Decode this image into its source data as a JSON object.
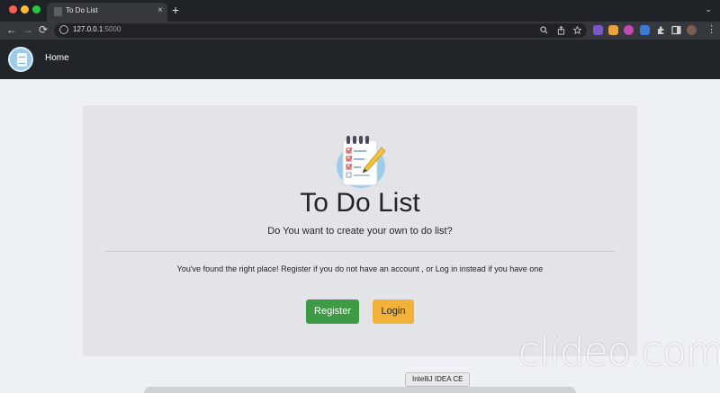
{
  "browser": {
    "tab_title": "To Do List",
    "tab_close": "×",
    "new_tab": "+",
    "tab_menu": "⌄",
    "url_host": "127.0.0.1",
    "url_port": ":5000",
    "back": "←",
    "forward": "→",
    "reload": "⟳",
    "extension_colors": [
      "#7a56c7",
      "#e8a33d",
      "#c04ab0",
      "#3b7ad9",
      "#9aa0a6",
      "#5a5a5a"
    ]
  },
  "navbar": {
    "brand_icon": "notepad-logo-icon",
    "home_label": "Home"
  },
  "hero": {
    "icon": "todo-list-clipboard-icon",
    "title": "To Do List",
    "lead": "Do You want to create your own to do list?",
    "text": "You've found the right place! Register if you do not have an account , or Log in instead if you have one",
    "register_label": "Register",
    "login_label": "Login",
    "colors": {
      "register": "#3f9a45",
      "login": "#f2b23a"
    }
  },
  "overlay": {
    "watermark": "clideo.com",
    "tooltip": "IntelliJ IDEA CE"
  }
}
